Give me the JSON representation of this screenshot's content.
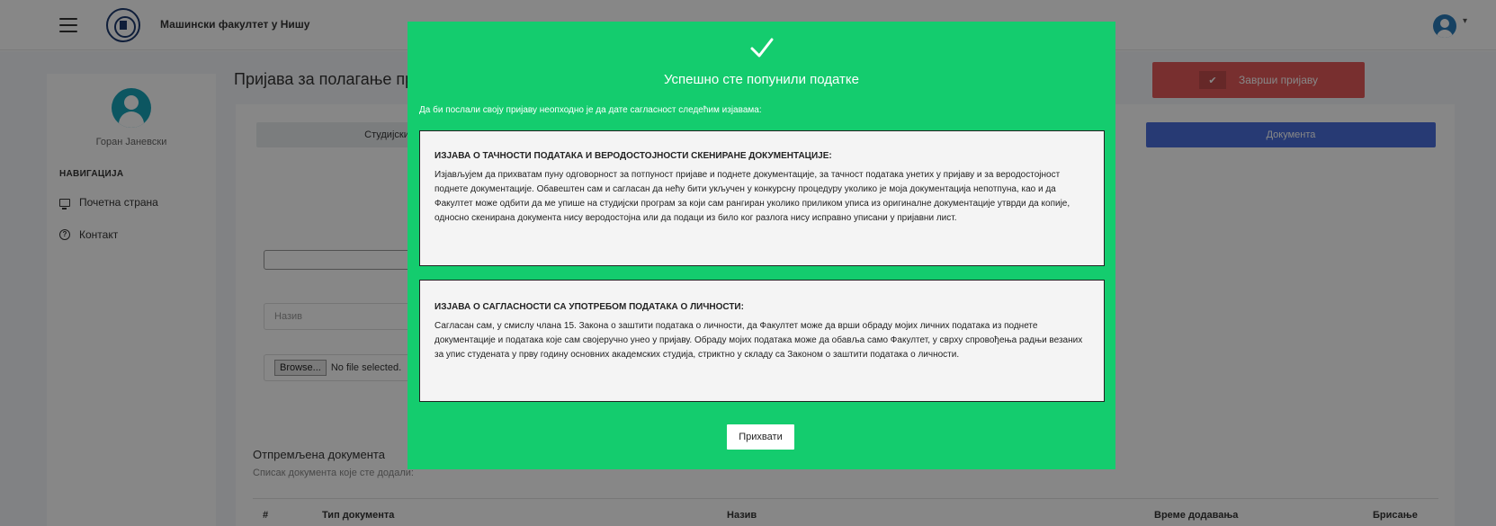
{
  "header": {
    "faculty_name": "Машински факултет у Нишу"
  },
  "sidebar": {
    "user_name": "Горан Јаневски",
    "nav_title": "НАВИГАЦИЈА",
    "items": [
      {
        "label": "Почетна страна",
        "icon": "monitor-icon"
      },
      {
        "label": "Контакт",
        "icon": "help-circle-icon"
      }
    ]
  },
  "main": {
    "page_title": "Пријава за полагање при",
    "finish_button": "Заврши пријаву",
    "tabs": [
      {
        "label": "Студијски"
      },
      {
        "label": "Документа"
      }
    ],
    "name_placeholder": "Назив",
    "file_input": {
      "button": "Browse...",
      "status": "No file selected."
    },
    "sent_documents": {
      "title": "Отпремљена документа",
      "subtitle": "Списак документа које сте додали:",
      "columns": [
        "#",
        "Тип документа",
        "Назив",
        "Време додавања",
        "Брисање"
      ]
    }
  },
  "modal": {
    "title": "Успешно сте попунили податке",
    "intro": "Да би послали своју пријаву неопходно је да дате сагласност следећим изјавама:",
    "declarations": [
      {
        "heading": "ИЗЈАВА О ТАЧНОСТИ ПОДАТАКА И ВЕРОДОСТОЈНОСТИ СКЕНИРАНЕ ДОКУМЕНТАЦИЈЕ:",
        "text": "Изјављујем да прихватам пуну одговорност за потпуност пријаве и поднете документације, за тачност података унетих у пријаву и за веродостојност поднете документације. Обавештен сам и сагласан да нећу бити укључен у конкурсну процедуру уколико је моја документација непотпуна, као и да Факултет може одбити да ме упише на студијски програм за који сам рангиран уколико приликом уписа из оригиналне документације утврди да копије, односно скенирана документа нису веродостојна или да подаци из било ког разлога нису исправно уписани у пријавни лист."
      },
      {
        "heading": "ИЗЈАВА О САГЛАСНОСТИ СА УПОТРЕБОМ ПОДАТАКА О ЛИЧНОСТИ:",
        "text": "Сагласан сам, у смислу члана 15. Закона о заштити података о личности, да Факултет може да врши обраду мојих личних података из поднете документације и података које сам својеручно унео у пријаву. Обраду мојих података може да обавља само Факултет, у сврху спровођења радњи везаних за упис студената у прву годину основних академских студија, стриктно у складу са Законом о заштити података о личности."
      }
    ],
    "accept_button": "Прихвати"
  },
  "colors": {
    "modal_green": "#14cc6e",
    "finish_red": "#e35a5a",
    "tab_blue": "#4a6fdc",
    "avatar_teal": "#17a2b8"
  }
}
